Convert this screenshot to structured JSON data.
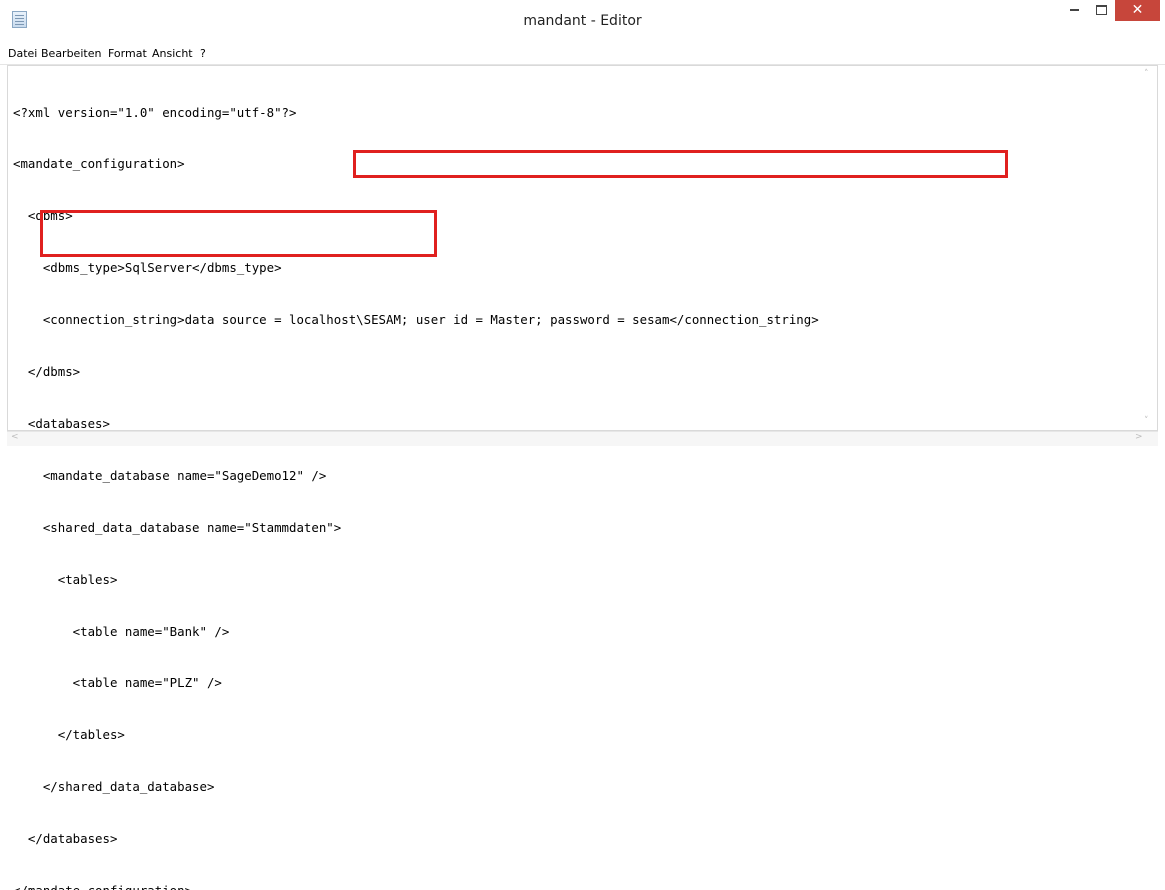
{
  "window": {
    "title": "mandant - Editor",
    "minimize_label": "",
    "maximize_label": "",
    "close_label": "✕"
  },
  "menu": [
    "Datei",
    "Bearbeiten",
    "Format",
    "Ansicht",
    "?"
  ],
  "editor": {
    "lines": [
      "<?xml version=\"1.0\" encoding=\"utf-8\"?>",
      "<mandate_configuration>",
      "  <dbms>",
      "    <dbms_type>SqlServer</dbms_type>",
      "    <connection_string>data source = localhost\\SESAM; user id = Master; password = sesam</connection_string>",
      "  </dbms>",
      "  <databases>",
      "    <mandate_database name=\"SageDemo12\" />",
      "    <shared_data_database name=\"Stammdaten\">",
      "      <tables>",
      "        <table name=\"Bank\" />",
      "        <table name=\"PLZ\" />",
      "      </tables>",
      "    </shared_data_database>",
      "  </databases>",
      "</mandate_configuration>"
    ]
  },
  "scroll": {
    "up": "˄",
    "down": "˅",
    "left": "<",
    "right": ">"
  },
  "colors": {
    "highlight": "#e0201f",
    "close_button": "#c7463b"
  }
}
